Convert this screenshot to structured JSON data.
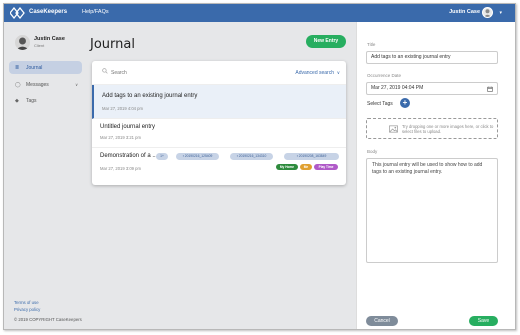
{
  "topbar": {
    "brand": "CaseKeepers",
    "help_link": "Help/FAQs",
    "user_name": "Justin Case",
    "caret": "▾"
  },
  "sidebar": {
    "profile_name": "Justin Case",
    "profile_role": "Client",
    "items": [
      {
        "label": "Journal",
        "icon": "journal-icon",
        "glyph": "≣",
        "active": true
      },
      {
        "label": "Messages",
        "icon": "chat-icon",
        "glyph": "◯",
        "chevron": "∨"
      },
      {
        "label": "Tags",
        "icon": "tag-icon",
        "glyph": "◆"
      }
    ],
    "terms": "Terms of use",
    "privacy": "Privacy policy",
    "copyright": "© 2019 COPYRIGHT CaseKeepers"
  },
  "main": {
    "title": "Journal",
    "new_entry": "New Entry",
    "search_placeholder": "Search",
    "advanced_search": "Advanced search",
    "advanced_chevron": "∨",
    "entries": [
      {
        "title": "Add tags to an existing journal entry",
        "date": "Mar 27, 2019 4:04 pm"
      },
      {
        "title": "Untitled journal entry",
        "date": "Mar 27, 2019 3:21 pm"
      },
      {
        "title": "Demonstration of a ...",
        "date": "Mar 27, 2019 3:09 pm",
        "attachments_more": "1+",
        "attachments": [
          "20190216_125409",
          "20190216_134310",
          "20190208_163849"
        ],
        "tags": [
          {
            "label": "My Home",
            "color": "#2e8b3d"
          },
          {
            "label": "Me",
            "color": "#e0a030"
          },
          {
            "label": "Play Time",
            "color": "#b05ac8"
          }
        ]
      }
    ]
  },
  "editor": {
    "title_label": "Title",
    "title_value": "Add tags to an existing journal entry",
    "date_label": "Occurrence Date",
    "date_value": "Mar 27, 2019 04:04 PM",
    "select_tags": "Select Tags",
    "add_glyph": "+",
    "dropzone_text": "Try dropping one or more images here, or click to select files to upload.",
    "body_label": "Body",
    "body_value": "This journal entry will be used to show how to add tags to an existing journal entry.",
    "cancel": "Cancel",
    "save": "Save"
  },
  "colors": {
    "topbar": "#3a6aab",
    "primary_green": "#27ae60",
    "cancel_gray": "#7f8c9a"
  }
}
